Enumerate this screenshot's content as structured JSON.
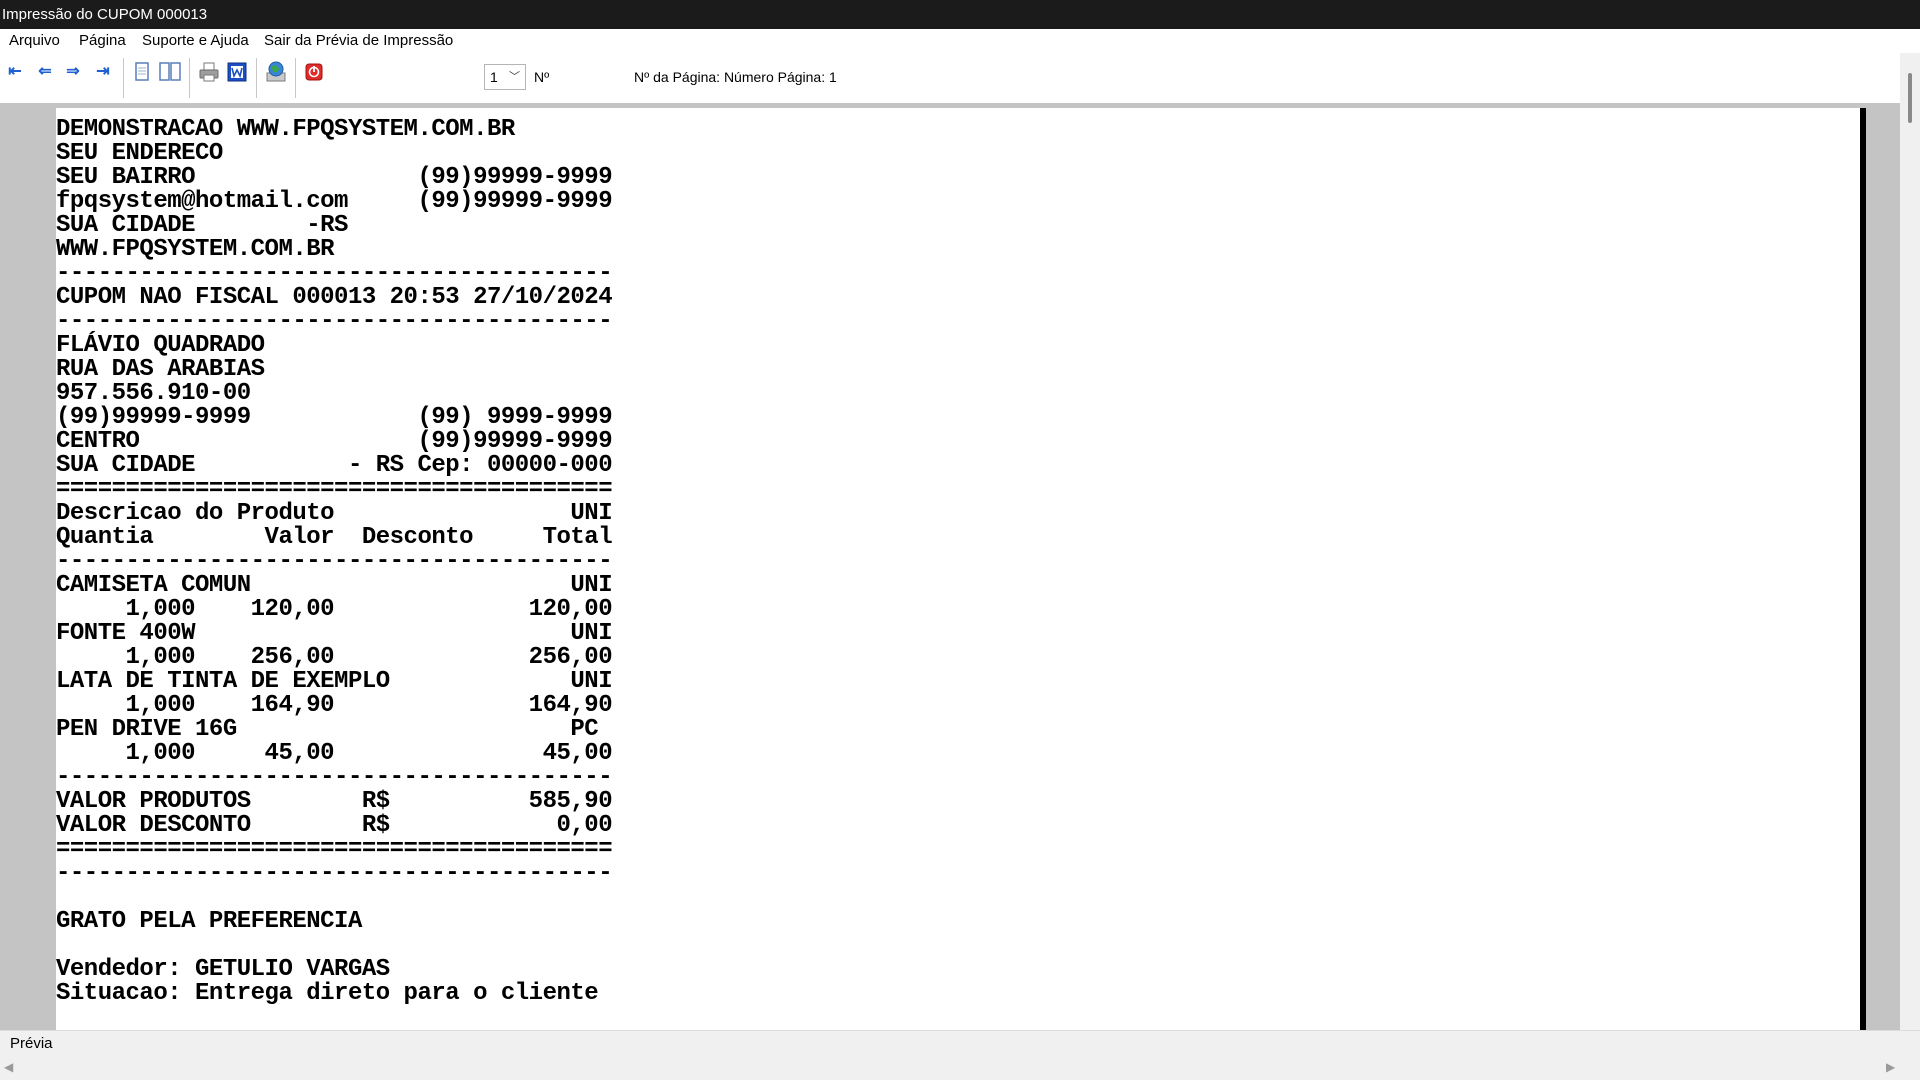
{
  "window": {
    "title": "Impressão do CUPOM 000013"
  },
  "menu": [
    {
      "label": "Arquivo"
    },
    {
      "label": "Página"
    },
    {
      "label": "Suporte e Ajuda"
    },
    {
      "label": "Sair da Prévia de Impressão"
    }
  ],
  "toolbar": {
    "buttons": [
      "first-page-icon",
      "previous-page-icon",
      "next-page-icon",
      "last-page-icon",
      "single-page-icon",
      "two-pages-icon",
      "print-icon",
      "word-export-icon",
      "web-export-icon",
      "close-preview-icon"
    ],
    "page_select_value": "1",
    "page_number_label": "Nº",
    "page_info": "Nº da Página: Número Página: 1"
  },
  "receipt": {
    "lines": [
      "DEMONSTRACAO WWW.FPQSYSTEM.COM.BR",
      "SEU ENDERECO",
      "SEU BAIRRO                (99)99999-9999",
      "fpqsystem@hotmail.com     (99)99999-9999",
      "SUA CIDADE        -RS",
      "WWW.FPQSYSTEM.COM.BR",
      "----------------------------------------",
      "CUPOM NAO FISCAL 000013 20:53 27/10/2024",
      "----------------------------------------",
      "FLÁVIO QUADRADO",
      "RUA DAS ARABIAS",
      "957.556.910-00",
      "(99)99999-9999            (99) 9999-9999",
      "CENTRO                    (99)99999-9999",
      "SUA CIDADE           - RS Cep: 00000-000",
      "========================================",
      "Descricao do Produto                 UNI",
      "Quantia        Valor  Desconto     Total",
      "----------------------------------------",
      "CAMISETA COMUN                       UNI",
      "     1,000    120,00              120,00",
      "FONTE 400W                           UNI",
      "     1,000    256,00              256,00",
      "LATA DE TINTA DE EXEMPLO             UNI",
      "     1,000    164,90              164,90",
      "PEN DRIVE 16G                        PC",
      "     1,000     45,00               45,00",
      "----------------------------------------",
      "VALOR PRODUTOS        R$          585,90",
      "VALOR DESCONTO        R$            0,00",
      "========================================",
      "----------------------------------------",
      "",
      "GRATO PELA PREFERENCIA",
      "",
      "Vendedor: GETULIO VARGAS",
      "Situacao: Entrega direto para o cliente"
    ]
  },
  "status": {
    "text": "Prévia"
  }
}
